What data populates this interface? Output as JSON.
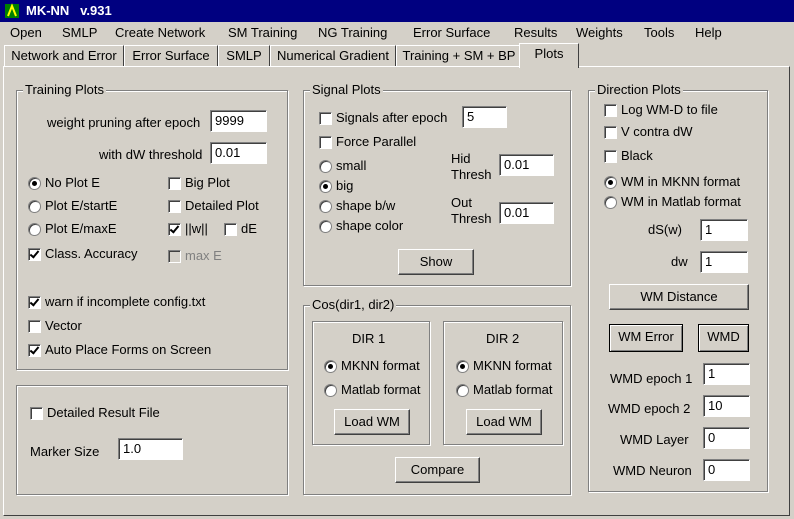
{
  "title": {
    "app": "MK-NN",
    "version": "v.931"
  },
  "menu": [
    "Open",
    "SMLP",
    "Create Network",
    "SM Training",
    "NG Training",
    "Error Surface",
    "Results",
    "Weights",
    "Tools",
    "Help"
  ],
  "tabs": [
    "Network and Error",
    "Error Surface",
    "SMLP",
    "Numerical Gradient",
    "Training + SM + BP",
    "Plots"
  ],
  "active_tab": "Plots",
  "training_plots": {
    "legend": "Training Plots",
    "weight_pruning_label": "weight pruning after epoch",
    "weight_pruning_value": "9999",
    "dw_threshold_label": "with dW threshold",
    "dw_threshold_value": "0.01",
    "radio": [
      {
        "label": "No Plot E",
        "checked": true
      },
      {
        "label": "Plot E/startE",
        "checked": false
      },
      {
        "label": "Plot E/maxE",
        "checked": false
      }
    ],
    "big_plot": {
      "label": "Big Plot",
      "checked": false
    },
    "detailed_plot": {
      "label": "Detailed Plot",
      "checked": false
    },
    "w_norm": {
      "label": "||w||",
      "checked": true
    },
    "de": {
      "label": "dE",
      "checked": false
    },
    "class_accuracy": {
      "label": "Class. Accuracy",
      "checked": true
    },
    "max_e": {
      "label": "max E",
      "checked": false,
      "disabled": true
    },
    "warn_incomplete": {
      "label": "warn if incomplete config.txt",
      "checked": true
    },
    "vector": {
      "label": "Vector",
      "checked": false
    },
    "auto_place": {
      "label": "Auto Place Forms on Screen",
      "checked": true
    }
  },
  "result": {
    "detailed_result": {
      "label": "Detailed Result File",
      "checked": false
    },
    "marker_size_label": "Marker Size",
    "marker_size_value": "1.0"
  },
  "signal_plots": {
    "legend": "Signal Plots",
    "signals_after_epoch": {
      "label": "Signals after epoch",
      "checked": false,
      "value": "5"
    },
    "force_parallel": {
      "label": "Force Parallel",
      "checked": false
    },
    "radio": [
      {
        "label": "small",
        "checked": false
      },
      {
        "label": "big",
        "checked": true
      },
      {
        "label": "shape b/w",
        "checked": false
      },
      {
        "label": "shape color",
        "checked": false
      }
    ],
    "hid_label_1": "Hid",
    "hid_label_2": "Thresh",
    "hid_value": "0.01",
    "out_label_1": "Out",
    "out_label_2": "Thresh",
    "out_value": "0.01",
    "show_button": "Show"
  },
  "cos": {
    "legend": "Cos(dir1, dir2)",
    "dir1": {
      "title": "DIR 1",
      "options": [
        {
          "label": "MKNN format",
          "checked": true
        },
        {
          "label": "Matlab format",
          "checked": false
        }
      ],
      "load_button": "Load WM"
    },
    "dir2": {
      "title": "DIR 2",
      "options": [
        {
          "label": "MKNN format",
          "checked": true
        },
        {
          "label": "Matlab format",
          "checked": false
        }
      ],
      "load_button": "Load WM"
    },
    "compare_button": "Compare"
  },
  "direction_plots": {
    "legend": "Direction Plots",
    "log_wmd": {
      "label": "Log WM-D to file",
      "checked": false
    },
    "v_contra": {
      "label": "V contra dW",
      "checked": false
    },
    "black": {
      "label": "Black",
      "checked": false
    },
    "radio": [
      {
        "label": "WM in MKNN format",
        "checked": true
      },
      {
        "label": "WM in Matlab format",
        "checked": false
      }
    ],
    "ds_label": "dS(w)",
    "ds_value": "1",
    "dw_label": "dw",
    "dw_value": "1",
    "wm_distance_button": "WM Distance",
    "wm_error_button": "WM Error",
    "wmd_button": "WMD",
    "wmd_epoch1_label": "WMD epoch 1",
    "wmd_epoch1_value": "1",
    "wmd_epoch2_label": "WMD epoch 2",
    "wmd_epoch2_value": "10",
    "wmd_layer_label": "WMD Layer",
    "wmd_layer_value": "0",
    "wmd_neuron_label": "WMD Neuron",
    "wmd_neuron_value": "0"
  },
  "icons": {
    "app": "app-icon"
  },
  "colors": {
    "titlebar": "#000080",
    "face": "#d4d0c8"
  }
}
